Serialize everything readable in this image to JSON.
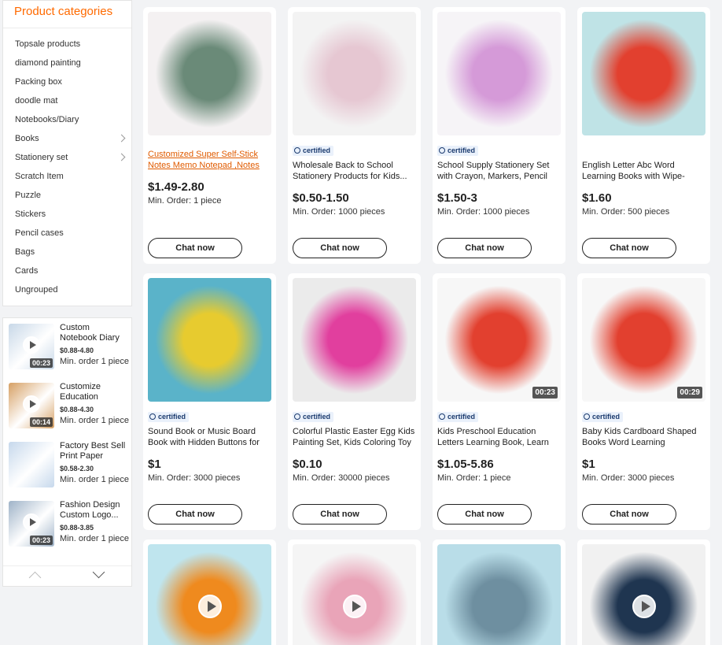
{
  "sidebar": {
    "title": "Product categories",
    "categories": [
      {
        "label": "Topsale products"
      },
      {
        "label": "diamond painting"
      },
      {
        "label": "Packing box"
      },
      {
        "label": "doodle mat"
      },
      {
        "label": "Notebooks/Diary"
      },
      {
        "label": "Books",
        "has_sub": true
      },
      {
        "label": "Stationery set",
        "has_sub": true
      },
      {
        "label": "Scratch Item"
      },
      {
        "label": "Puzzle"
      },
      {
        "label": "Stickers"
      },
      {
        "label": "Pencil cases"
      },
      {
        "label": "Bags"
      },
      {
        "label": "Cards"
      },
      {
        "label": "Ungrouped"
      }
    ]
  },
  "recommended": [
    {
      "name": "Custom Notebook Diary Journal...",
      "price": "$0.88-4.80",
      "moq": "Min. order 1 piece",
      "duration": "00:23",
      "video": true,
      "thumb_color": "#c8d8e8"
    },
    {
      "name": "Customize Education Magic...",
      "price": "$0.88-4.30",
      "moq": "Min. order 1 piece",
      "duration": "00:14",
      "video": true,
      "thumb_color": "#d6a064"
    },
    {
      "name": "Factory Best Sell Print Paper Diary,...",
      "price": "$0.58-2.30",
      "moq": "Min. order 1 piece",
      "duration": "",
      "video": false,
      "thumb_color": "#c6d8ec"
    },
    {
      "name": "Fashion Design Custom Logo...",
      "price": "$0.88-3.85",
      "moq": "Min. order 1 piece",
      "duration": "00:23",
      "video": true,
      "thumb_color": "#9fb3c8"
    }
  ],
  "products": [
    {
      "name": "Customized Super Self-Stick Notes Memo Notepad ,Notes Pa...",
      "link": true,
      "certified": false,
      "price": "$1.49-2.80",
      "moq": "Min. Order: 1 piece",
      "chat": "Chat now",
      "duration": "",
      "play": false,
      "img_color": "#f4f1f2",
      "img_art": "#6a8a78"
    },
    {
      "name": "Wholesale Back to School Stationery Products for Kids...",
      "link": false,
      "certified": true,
      "cert_label": "certified",
      "price": "$0.50-1.50",
      "moq": "Min. Order: 1000 pieces",
      "chat": "Chat now",
      "duration": "",
      "play": false,
      "img_color": "#f3f3f3",
      "img_art": "#e6c7d2"
    },
    {
      "name": "School Supply Stationery Set with Crayon, Markers, Pencil Pouch...",
      "link": false,
      "certified": true,
      "cert_label": "certified",
      "price": "$1.50-3",
      "moq": "Min. Order: 1000 pieces",
      "chat": "Chat now",
      "duration": "",
      "play": false,
      "img_color": "#f6f4f7",
      "img_art": "#d59ad8"
    },
    {
      "name": "English Letter Abc Word Learning Books with Wipe-clean Pen Lear...",
      "link": false,
      "certified": false,
      "price": "$1.60",
      "moq": "Min. Order: 500 pieces",
      "chat": "Chat now",
      "duration": "",
      "play": false,
      "img_color": "#bfe3e6",
      "img_art": "#e2402f"
    },
    {
      "name": "Sound Book or Music Board Book with Hidden Buttons for Kids,...",
      "link": false,
      "certified": true,
      "cert_label": "certified",
      "price": "$1",
      "moq": "Min. Order: 3000 pieces",
      "chat": "Chat now",
      "duration": "",
      "play": false,
      "img_color": "#5ab3c9",
      "img_art": "#e7cb2f"
    },
    {
      "name": "Colorful Plastic Easter Egg Kids Painting Set, Kids Coloring Toy",
      "link": false,
      "certified": true,
      "cert_label": "certified",
      "price": "$0.10",
      "moq": "Min. Order: 30000 pieces",
      "chat": "Chat now",
      "duration": "",
      "play": false,
      "img_color": "#ebebeb",
      "img_art": "#e13f9e"
    },
    {
      "name": "Kids Preschool Education Letters Learning Book, Learn English Fir...",
      "link": false,
      "certified": true,
      "cert_label": "certified",
      "price": "$1.05-5.86",
      "moq": "Min. Order: 1 piece",
      "chat": "Chat now",
      "duration": "00:23",
      "play": false,
      "img_color": "#f7f7f7",
      "img_art": "#e2402f"
    },
    {
      "name": "Baby Kids Cardboard Shaped Books Word Learning Counting...",
      "link": false,
      "certified": true,
      "cert_label": "certified",
      "price": "$1",
      "moq": "Min. Order: 3000 pieces",
      "chat": "Chat now",
      "duration": "00:29",
      "play": false,
      "img_color": "#f7f7f7",
      "img_art": "#e2402f"
    },
    {
      "name": "",
      "link": false,
      "certified": false,
      "price": "",
      "moq": "",
      "chat": "",
      "duration": "",
      "play": true,
      "img_color": "#bfe5ee",
      "img_art": "#ef8a1e"
    },
    {
      "name": "",
      "link": false,
      "certified": false,
      "price": "",
      "moq": "",
      "chat": "",
      "duration": "",
      "play": true,
      "img_color": "#f5f5f5",
      "img_art": "#e9a4b8"
    },
    {
      "name": "",
      "link": false,
      "certified": false,
      "price": "",
      "moq": "",
      "chat": "",
      "duration": "",
      "play": false,
      "img_color": "#b9dde8",
      "img_art": "#6e8fa0"
    },
    {
      "name": "",
      "link": false,
      "certified": false,
      "price": "",
      "moq": "",
      "chat": "",
      "duration": "",
      "play": true,
      "img_color": "#f1f1f1",
      "img_art": "#1f3550"
    }
  ]
}
